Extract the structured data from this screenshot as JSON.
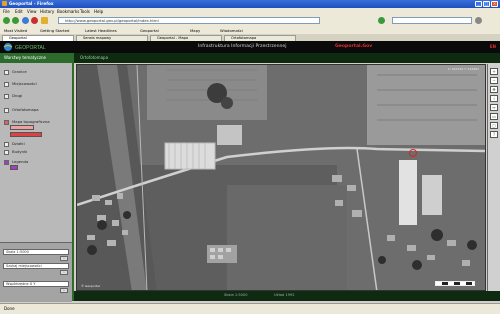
{
  "browser": {
    "title": "Geoportal - Firefox",
    "menu": [
      "File",
      "Edit",
      "View",
      "History",
      "Bookmarks",
      "Tools",
      "Help"
    ],
    "url": "http://www.geoportal.gov.pl/geoportal/index.html",
    "search_placeholder": "Google",
    "bookmarks": [
      "Most Visited",
      "Getting Started",
      "Latest Headlines",
      "Geoportal",
      "Mapy",
      "Wiadomości"
    ],
    "tabs": [
      "Geoportal",
      "Serwis mapowy",
      "Geoportal - Mapa",
      "Ortofotomapa"
    ],
    "status": "Done"
  },
  "site": {
    "logo_text": "GEOPORTAL",
    "title": "Infrastruktura Informacji Przestrzennej",
    "brand": "Geoportal.Gov",
    "lang": "EN"
  },
  "left_panel": {
    "header": "Warstwy tematyczne",
    "items": [
      "Granice",
      "Miejscowości",
      "Drogi",
      "Ortofotomapa",
      "Mapa topograficzna",
      "Działki",
      "Budynki",
      "Legenda"
    ],
    "tools": [
      "Skala 1:5000",
      "Szukaj miejscowości",
      "Współrzędne X Y"
    ]
  },
  "map": {
    "tab_label": "Ortofotomapa",
    "coords": "X: 507234  Y: 312981",
    "copyright": "© Geoportal",
    "bottom": [
      "Skala 1:5000",
      "Układ 1992"
    ]
  },
  "colors": {
    "accent": "#2d6b2d",
    "header_bg": "#0a0a0a",
    "brand": "#e03030",
    "marker": "#e02020"
  }
}
